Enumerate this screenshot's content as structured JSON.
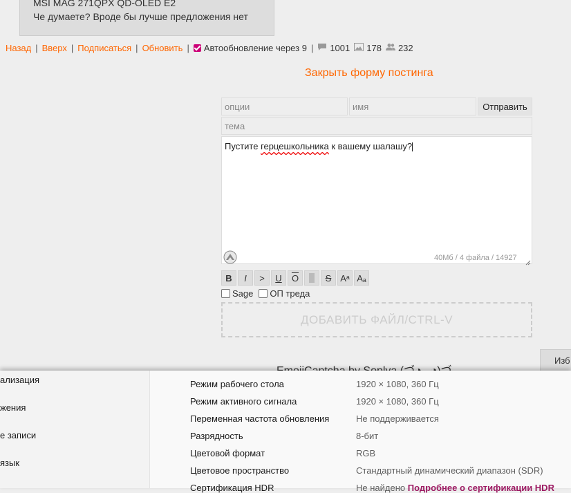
{
  "post": {
    "line1": "MSI MAG 271QPX QD-OLED E2",
    "line2": "Че думаете? Вроде бы лучше предложения нет"
  },
  "nav": {
    "back": "Назад",
    "top": "Вверх",
    "subscribe": "Подписаться",
    "refresh": "Обновить",
    "autorefresh": "Автообновление через 9",
    "posts_count": "1001",
    "images_count": "178",
    "users_count": "232",
    "sep": "|"
  },
  "form": {
    "close_label": "Закрыть форму постинга",
    "options_placeholder": "опции",
    "name_placeholder": "имя",
    "send_label": "Отправить",
    "subject_placeholder": "тема",
    "text_before": "Пустите ",
    "text_misspelled": "герцешкольника",
    "text_after": " к вашему шалашу?",
    "limits": "40Мб / 4 файла / 14927",
    "markup_buttons": [
      "B",
      "I",
      ">",
      "U",
      "O",
      "",
      "S",
      "Aᵃ",
      "Aₐ"
    ],
    "sage_label": "Sage",
    "op_label": "ОП треда",
    "dropzone_label": "ДОБАВИТЬ ФАЙЛ/CTRL-V",
    "captcha_title": "EmojiCaptcha by Soplya (づ◕‿◕)づ",
    "fav_label": "Изб"
  },
  "settings": {
    "sidebar": [
      "ализация",
      "жения",
      "е записи",
      "язык"
    ],
    "rows": [
      {
        "label": "Режим рабочего стола",
        "value": "1920 × 1080, 360 Гц"
      },
      {
        "label": "Режим активного сигнала",
        "value": "1920 × 1080, 360 Гц"
      },
      {
        "label": "Переменная частота обновления",
        "value": "Не поддерживается"
      },
      {
        "label": "Разрядность",
        "value": "8-бит"
      },
      {
        "label": "Цветовой формат",
        "value": "RGB"
      },
      {
        "label": "Цветовое пространство",
        "value": "Стандартный динамический диапазон (SDR)"
      },
      {
        "label": "Сертификация HDR",
        "value": "Не найдено",
        "link": "Подробнее о сертификации HDR"
      }
    ]
  },
  "colors": {
    "accent": "#ff6600",
    "checkbox": "#cc0077",
    "link": "#9c1a62"
  }
}
